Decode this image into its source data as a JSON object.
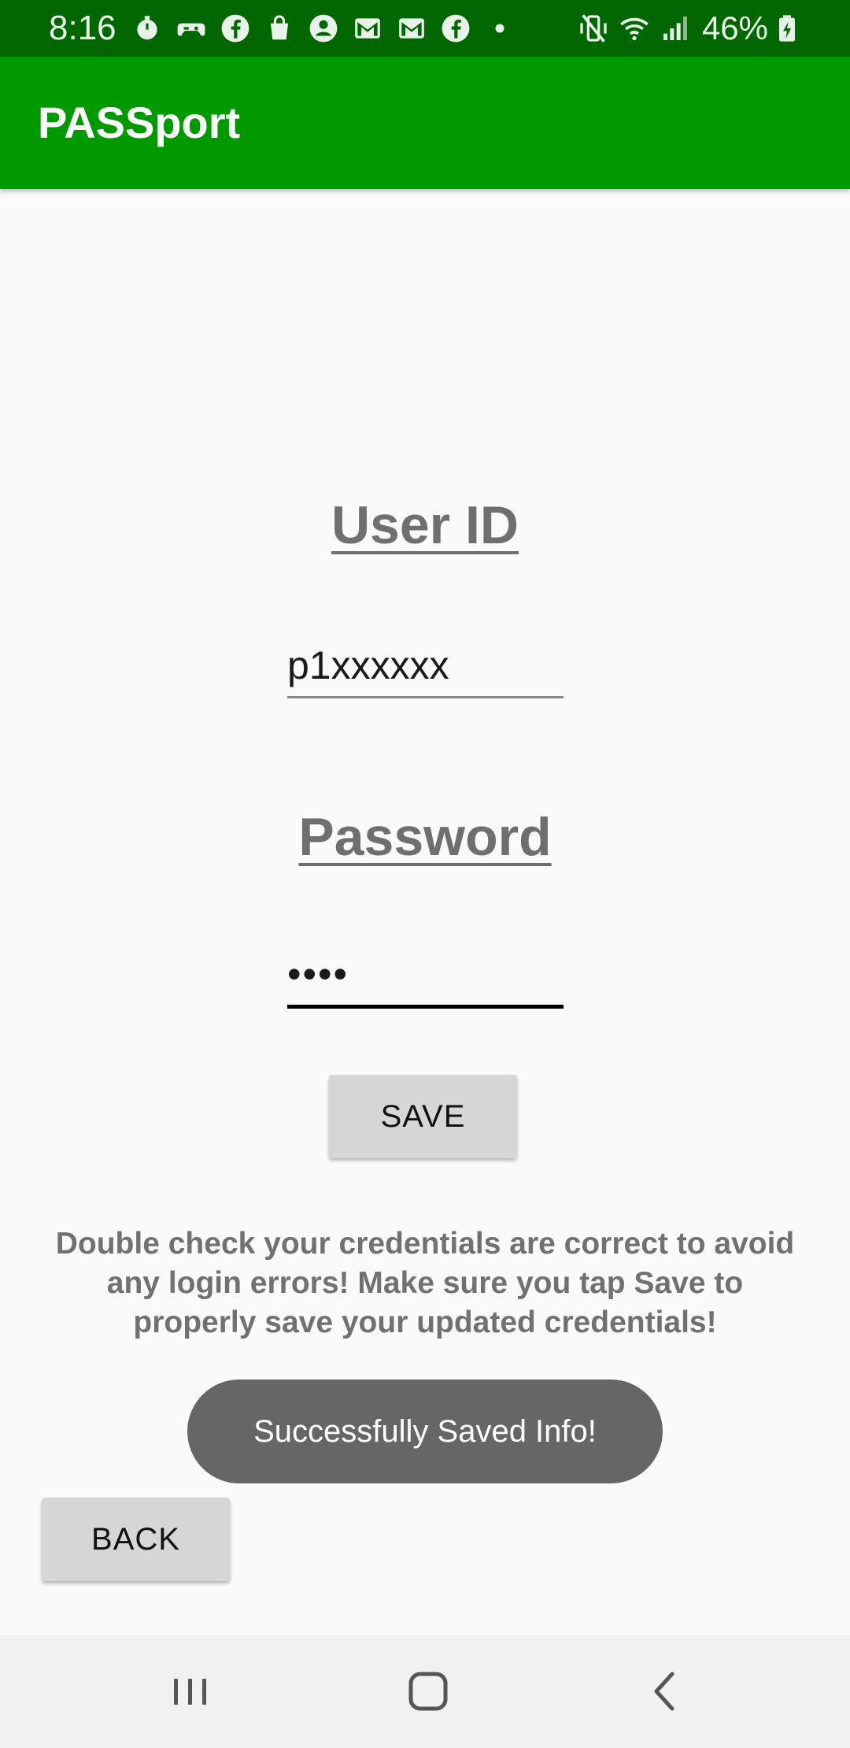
{
  "status_bar": {
    "time": "8:16",
    "battery_percent": "46%",
    "icons_left": [
      "timer-icon",
      "game-controller-icon",
      "facebook-icon",
      "shopping-bag-icon",
      "account-icon",
      "gmail-icon",
      "gmail-icon",
      "facebook-icon",
      "dot-icon"
    ],
    "icons_right": [
      "vibrate-mute-icon",
      "wifi-icon",
      "signal-icon",
      "battery-charging-icon"
    ]
  },
  "app_bar": {
    "title": "PASSport",
    "color": "#009900"
  },
  "form": {
    "user_id_label": "User ID",
    "user_id_value": "p1xxxxxx",
    "password_label": "Password",
    "password_value": "••••",
    "save_label": "SAVE"
  },
  "hint": "Double check your credentials are correct to avoid any login errors! Make sure you tap Save to properly save your updated credentials!",
  "toast": "Successfully Saved Info!",
  "back_label": "BACK",
  "nav_bar": {
    "buttons": [
      "recents-icon",
      "home-icon",
      "back-arrow-icon"
    ]
  }
}
